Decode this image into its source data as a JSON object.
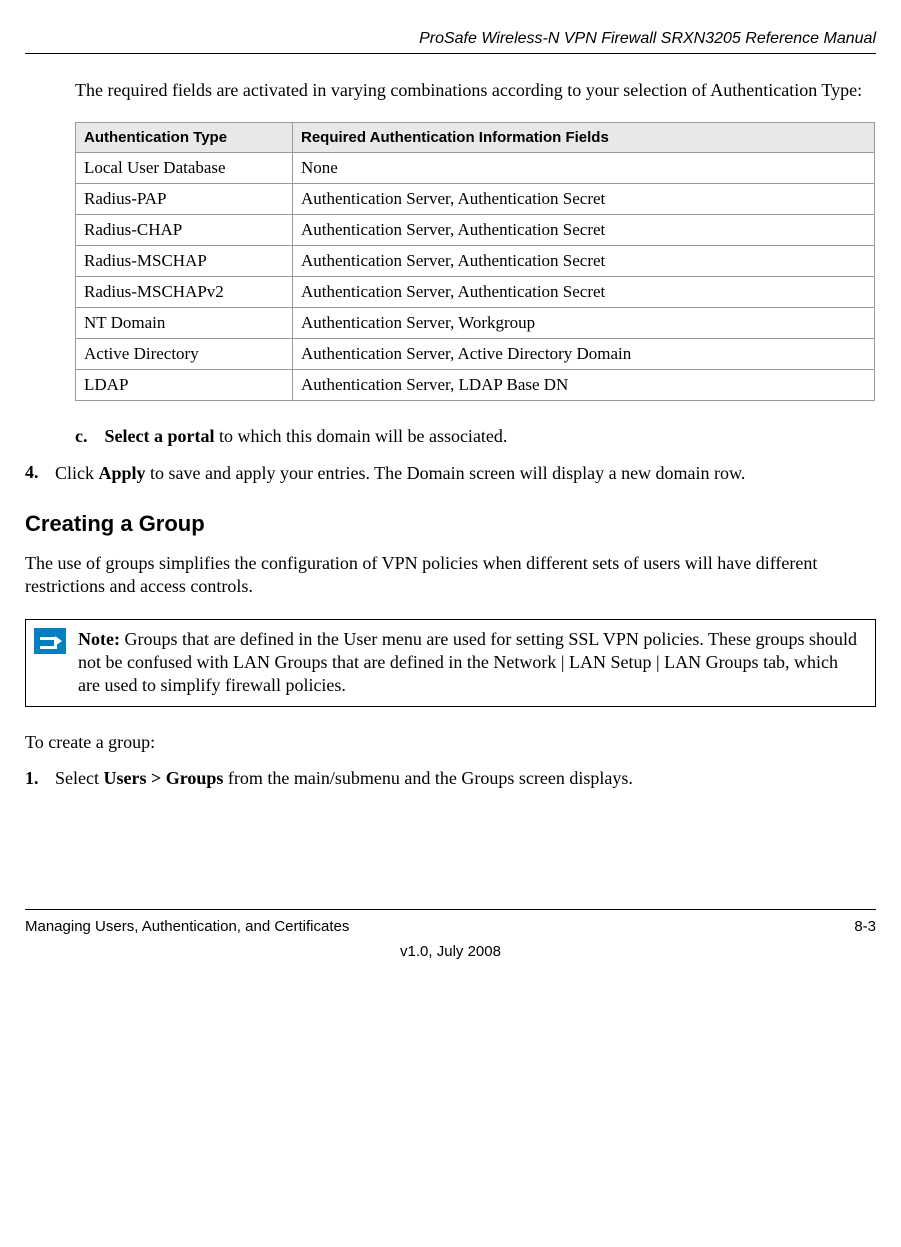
{
  "header": {
    "title": "ProSafe Wireless-N VPN Firewall SRXN3205 Reference Manual"
  },
  "intro": "The required fields are activated in varying combinations according to your selection of Authentication Type:",
  "table": {
    "headers": [
      "Authentication Type",
      "Required Authentication Information Fields"
    ],
    "rows": [
      [
        "Local User Database",
        "None"
      ],
      [
        "Radius-PAP",
        "Authentication Server, Authentication Secret"
      ],
      [
        "Radius-CHAP",
        "Authentication Server, Authentication Secret"
      ],
      [
        "Radius-MSCHAP",
        "Authentication Server, Authentication Secret"
      ],
      [
        "Radius-MSCHAPv2",
        "Authentication Server, Authentication Secret"
      ],
      [
        "NT Domain",
        "Authentication Server, Workgroup"
      ],
      [
        "Active Directory",
        "Authentication Server, Active Directory Domain"
      ],
      [
        "LDAP",
        "Authentication Server, LDAP Base DN"
      ]
    ]
  },
  "step_c": {
    "letter": "c.",
    "bold": "Select a portal",
    "rest": " to which this domain will be associated."
  },
  "step_4": {
    "number": "4.",
    "pre": "Click ",
    "bold": "Apply",
    "post": " to save and apply your entries. The Domain screen will display a new domain row."
  },
  "heading": "Creating a Group",
  "group_intro": "The use of groups simplifies the configuration of VPN policies when different sets of users will have different restrictions and access controls.",
  "note": {
    "label": "Note:",
    "text": " Groups that are defined in the User menu are used for setting SSL VPN policies. These groups should not be confused with LAN Groups that are defined in the Network | LAN Setup | LAN Groups tab, which are used to simplify firewall policies."
  },
  "to_create": "To create a group:",
  "step_1": {
    "number": "1.",
    "pre": "Select ",
    "bold": "Users > Groups",
    "post": " from the main/submenu and the Groups screen displays."
  },
  "footer": {
    "left": "Managing Users, Authentication, and Certificates",
    "right": "8-3",
    "version": "v1.0, July 2008"
  }
}
